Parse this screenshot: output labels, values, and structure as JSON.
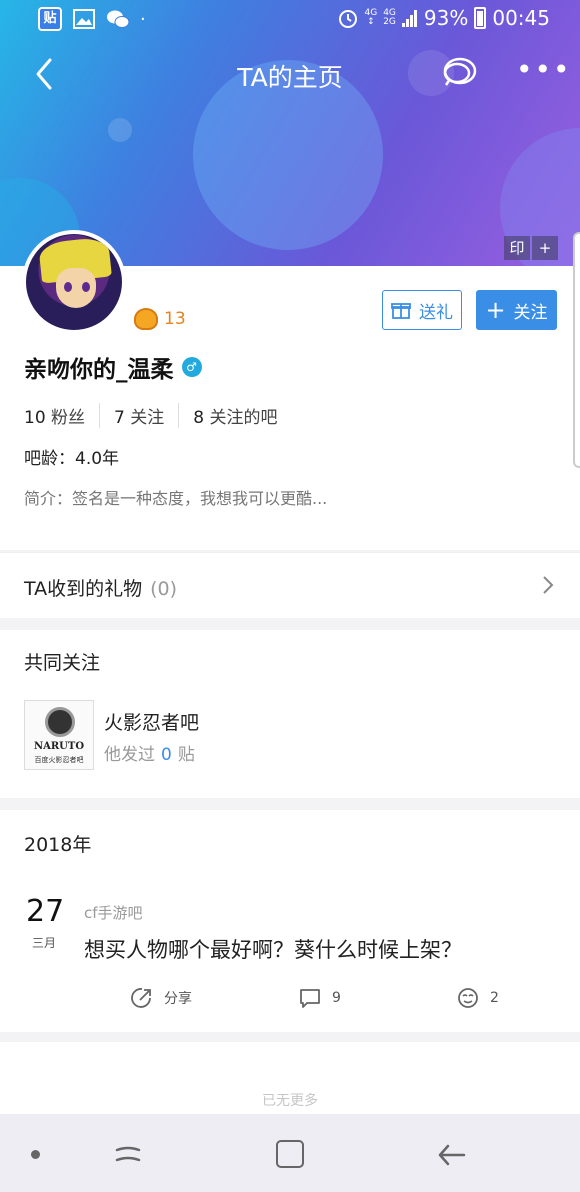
{
  "status_bar": {
    "battery": "93%",
    "time": "00:45",
    "app_icon_label": "贴",
    "net_top": "4G",
    "net_bottom": "4G",
    "net_bottom2": "2G"
  },
  "nav": {
    "title": "TA的主页"
  },
  "header_buttons": {
    "stamp": "印",
    "add": "+"
  },
  "profile": {
    "level": "13",
    "gift_button": "送礼",
    "follow_button": "关注",
    "username": "亲吻你的_温柔",
    "stats": [
      {
        "num": "10",
        "label": "粉丝"
      },
      {
        "num": "7",
        "label": "关注"
      },
      {
        "num": "8",
        "label": "关注的吧"
      }
    ],
    "age": "吧龄：4.0年",
    "intro": "简介：签名是一种态度，我想我可以更酷..."
  },
  "gifts": {
    "label": "TA收到的礼物",
    "count": "(0)"
  },
  "common": {
    "title": "共同关注",
    "bar": {
      "name": "火影忍者吧",
      "posts_prefix": "他发过",
      "posts_count": "0",
      "posts_suffix": "贴",
      "thumb_text": "NARUTO",
      "thumb_sub": "百度火影忍者吧"
    }
  },
  "timeline": {
    "year": "2018年",
    "day": "27",
    "month": "三月",
    "bar": "cf手游吧",
    "title": "想买人物哪个最好啊？葵什么时候上架？",
    "share_label": "分享",
    "comments": "9",
    "likes": "2"
  },
  "footer": {
    "end_text": "已无更多"
  },
  "colors": {
    "accent": "#3a8ee6",
    "level": "#e5831e",
    "header_start": "#26b6e6",
    "header_end": "#9a5fe0"
  }
}
